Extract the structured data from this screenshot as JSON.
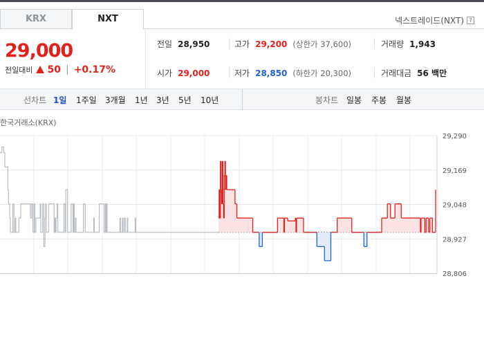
{
  "tabs": {
    "krx": "KRX",
    "nxt": "NXT"
  },
  "nxt_link": {
    "label": "넥스트레이드(NXT)",
    "help_icon": "question-icon",
    "help_glyph": "?"
  },
  "price": {
    "current": "29,000",
    "change_label": "전일대비",
    "change_value": "50",
    "change_rate": "+0.17%",
    "direction": "up"
  },
  "stats": {
    "prev_close": {
      "label": "전일",
      "value": "28,950"
    },
    "high": {
      "label": "고가",
      "value": "29,200",
      "sub": "(상한가 37,600)"
    },
    "volume": {
      "label": "거래량",
      "value": "1,943"
    },
    "open": {
      "label": "시가",
      "value": "29,000"
    },
    "low": {
      "label": "저가",
      "value": "28,850",
      "sub": "(하한가 20,300)"
    },
    "turnover": {
      "label": "거래대금",
      "value": "56 백만"
    }
  },
  "period_bar": {
    "line_chart_label": "선차트",
    "line_periods": [
      "1일",
      "1주일",
      "3개월",
      "1년",
      "3년",
      "5년",
      "10년"
    ],
    "active_period": "1일",
    "candle_chart_label": "봉차트",
    "candle_periods": [
      "일봉",
      "주봉",
      "월봉"
    ]
  },
  "chart": {
    "exchange_label": "한국거래소(KRX)",
    "colors": {
      "up": "#e1221c",
      "down": "#1f63d4",
      "other": "#b8bcc3",
      "up_fill": "#fbe3e3",
      "down_fill": "#e1ebfa",
      "grid": "#e6e8eb"
    }
  },
  "chart_data": {
    "type": "line",
    "y_ticks": [
      "29,290",
      "29,169",
      "29,048",
      "28,927",
      "28,806"
    ],
    "ylim": [
      28806,
      29290
    ],
    "baseline": 28950,
    "series": [
      {
        "segment": "krx",
        "values": [
          29230,
          29230,
          29230,
          29250,
          29250,
          29250,
          29230,
          29230,
          29180,
          29180,
          29180,
          29180,
          29180,
          29100,
          29050,
          29050,
          29000,
          28950,
          28950,
          28950,
          28950,
          29050,
          29050,
          28950,
          28950,
          29000,
          28950,
          28950,
          28950,
          28950,
          28950,
          29000,
          29000,
          29000,
          29050,
          29050,
          29050,
          29050,
          29050,
          29050,
          29050,
          29050,
          29050,
          29050,
          29050,
          29050,
          29050,
          29050,
          29050,
          29050,
          29000,
          29000,
          29050,
          29050,
          28950,
          28950,
          29050,
          28950,
          28950,
          29000,
          29000,
          29000,
          29000,
          29000,
          29000,
          29000,
          29050,
          28950,
          28950,
          28950,
          29050,
          29050,
          28900,
          28900,
          29000,
          29050,
          28950,
          28950,
          28950,
          28950,
          29050,
          29050,
          29050,
          29050,
          29050,
          29050,
          29050,
          29050,
          29050,
          28950,
          29000,
          28950,
          29000,
          29000,
          29050,
          28950,
          28950,
          28950,
          28950,
          28950,
          28950,
          28950,
          28950,
          28950,
          28950,
          29050,
          29050,
          28950,
          29100,
          29100,
          29100,
          28950,
          28950,
          28950,
          28950,
          28950,
          28950,
          29050,
          29050,
          29050,
          28950,
          29050,
          28950,
          28950,
          29000,
          28950,
          28950,
          28950,
          28950,
          28950,
          28950,
          28950,
          28950,
          28950,
          28950,
          28950,
          28950,
          29050,
          29050,
          29050,
          28950,
          28950,
          28950,
          28950,
          28950,
          28950,
          28950,
          28950,
          28950,
          28950,
          28950,
          28950,
          28950,
          28950,
          29000,
          28950,
          28950,
          28950,
          28950,
          28950,
          28950,
          28950,
          28950,
          29050,
          29050,
          29050,
          29050,
          29050,
          29050,
          29050,
          29050,
          28950,
          28950,
          29050,
          28950,
          29050,
          28950,
          28950,
          28950,
          28950,
          28950,
          28950,
          28950,
          28950,
          28950,
          28950,
          28950,
          28950,
          28950,
          28950,
          28950,
          28950,
          28950,
          28950,
          28950,
          28950,
          28950,
          29000,
          28950,
          28950,
          28950,
          29000,
          28950,
          28950,
          29000,
          29000,
          28950,
          28950,
          28950,
          29000,
          28950,
          28950,
          28950,
          28950,
          28950,
          28950,
          28950,
          28950,
          28950,
          28950,
          28950,
          28950,
          29000,
          28950,
          28950,
          28950,
          28950,
          28950,
          28950,
          28950,
          28950,
          28950,
          28950,
          28950,
          28950,
          28950,
          28950,
          28950,
          28950,
          28950,
          28950,
          28950,
          28950,
          28950,
          28950,
          28950,
          28950,
          28950,
          28950,
          28950,
          28950,
          28950,
          28950,
          28950,
          28950,
          28950,
          28950,
          28950,
          28950,
          28950,
          28950,
          28950,
          28950,
          28950,
          28950,
          28950,
          28950,
          28950,
          28950,
          28950,
          28950,
          28950,
          28950,
          28950,
          28950,
          28950,
          28950,
          28950,
          28950,
          28950,
          28950,
          28950,
          28950,
          28950,
          28950,
          28950,
          28950,
          28950,
          28950,
          28950,
          28950,
          28950,
          28950,
          28950,
          28950,
          28950,
          28950,
          28950,
          28950,
          28950,
          28950,
          28950,
          28950,
          28950,
          28950,
          28950,
          28950,
          28950,
          28950,
          28950,
          28950,
          28950,
          28950,
          28950,
          28950,
          28950,
          28950,
          28950,
          28950,
          28950,
          28950,
          28950,
          28950,
          28950,
          28950,
          28950,
          28950,
          28950,
          28950,
          28950,
          28950,
          28950,
          28950,
          28950,
          28950,
          28950,
          28950,
          28950,
          28950,
          28950,
          28950,
          28950,
          28950,
          28950,
          28950,
          28950,
          28950,
          28950,
          28950,
          28950,
          28950,
          28950,
          28950,
          28950,
          28950,
          28950,
          28950,
          28950,
          28950,
          28950
        ]
      },
      {
        "segment": "nxt",
        "values": [
          29000,
          29100,
          29000,
          29200,
          29100,
          29050,
          29200,
          29050,
          29000,
          29150,
          29200,
          29100,
          29150,
          29100,
          29100,
          29100,
          29100,
          29100,
          29100,
          29100,
          29100,
          29100,
          29100,
          29100,
          29100,
          29100,
          29050,
          29050,
          29050,
          29000,
          29000,
          29000,
          29000,
          29000,
          29000,
          29000,
          29000,
          29000,
          29000,
          29000,
          29000,
          29000,
          29000,
          29000,
          29000,
          29000,
          29000,
          29000,
          29000,
          29000,
          29000,
          29000,
          29000,
          29000,
          28950,
          28950,
          28950,
          28950,
          28950,
          28950,
          28950,
          28950,
          28950,
          28950,
          28900,
          28900,
          28900,
          28900,
          28900,
          28950,
          28950,
          28950,
          28950,
          28950,
          28950,
          28950,
          28950,
          28950,
          28950,
          28950,
          28950,
          28950,
          28950,
          28950,
          28950,
          28950,
          28950,
          28950,
          28950,
          28950,
          28950,
          28950,
          28950,
          29000,
          29000,
          29000,
          29000,
          29000,
          29000,
          29000,
          29000,
          29000,
          29000,
          28950,
          29000,
          29000,
          29000,
          29000,
          29000,
          28990,
          28990,
          28990,
          28990,
          28990,
          28990,
          28990,
          28990,
          28990,
          28990,
          28990,
          28990,
          29000,
          28950,
          29000,
          29000,
          29000,
          29000,
          29000,
          29000,
          29000,
          29000,
          29000,
          29000,
          29000,
          28950,
          28950,
          28950,
          28950,
          28950,
          28950,
          28950,
          28950,
          28950,
          28950,
          28950,
          28950,
          28950,
          28950,
          28950,
          28950,
          28950,
          28950,
          28950,
          28950,
          28950,
          28900,
          28900,
          28900,
          28900,
          28900,
          28900,
          28900,
          28900,
          28900,
          28900,
          28900,
          28900,
          28850,
          28850,
          28850,
          28850,
          28850,
          28850,
          28850,
          28850,
          28850,
          28850,
          28950,
          28950,
          28950,
          28950,
          28950,
          28950,
          28950,
          28950,
          28950,
          28950,
          29000,
          29000,
          29000,
          29000,
          29000,
          29000,
          29000,
          29000,
          29000,
          29000,
          29000,
          29000,
          29000,
          29000,
          29000,
          29000,
          29000,
          29000,
          29000,
          29000,
          29000,
          29000,
          29000,
          28950,
          28950,
          28950,
          28950,
          28950,
          28950,
          28950,
          28950,
          28950,
          28950,
          28950,
          28950,
          28950,
          28950,
          28950,
          28950,
          28950,
          28950,
          28950,
          28900,
          28900,
          28900,
          28900,
          28900,
          28950,
          28950,
          28950,
          28950,
          28950,
          28950,
          28950,
          28950,
          28950,
          28950,
          28950,
          28950,
          28950,
          28950,
          28950,
          28950,
          28950,
          28950,
          28950,
          28950,
          28950,
          28950,
          28950,
          29000,
          29000,
          29000,
          29000,
          29000,
          29000,
          29000,
          29000,
          29000,
          29050,
          29050,
          29050,
          29050,
          29050,
          29000,
          29000,
          29000,
          29000,
          29000,
          29000,
          29000,
          29050,
          29050,
          29050,
          29050,
          29050,
          29050,
          29050,
          29050,
          29050,
          29050,
          29000,
          29000,
          29000,
          29000,
          29000,
          29000,
          29000,
          29000,
          29000,
          29000,
          29000,
          29000,
          29000,
          29000,
          29000,
          29000,
          29000,
          29000,
          29000,
          29000,
          29000,
          29000,
          29000,
          29000,
          29000,
          29000,
          29000,
          29000,
          29000,
          29000,
          28950,
          29000,
          29000,
          29000,
          29000,
          29000,
          29000,
          28950,
          28950,
          29000,
          29000,
          29000,
          29000,
          28950,
          28950,
          29000,
          29000,
          29000,
          29000,
          28950,
          28950,
          28950,
          28950,
          28950,
          29100
        ]
      }
    ]
  }
}
